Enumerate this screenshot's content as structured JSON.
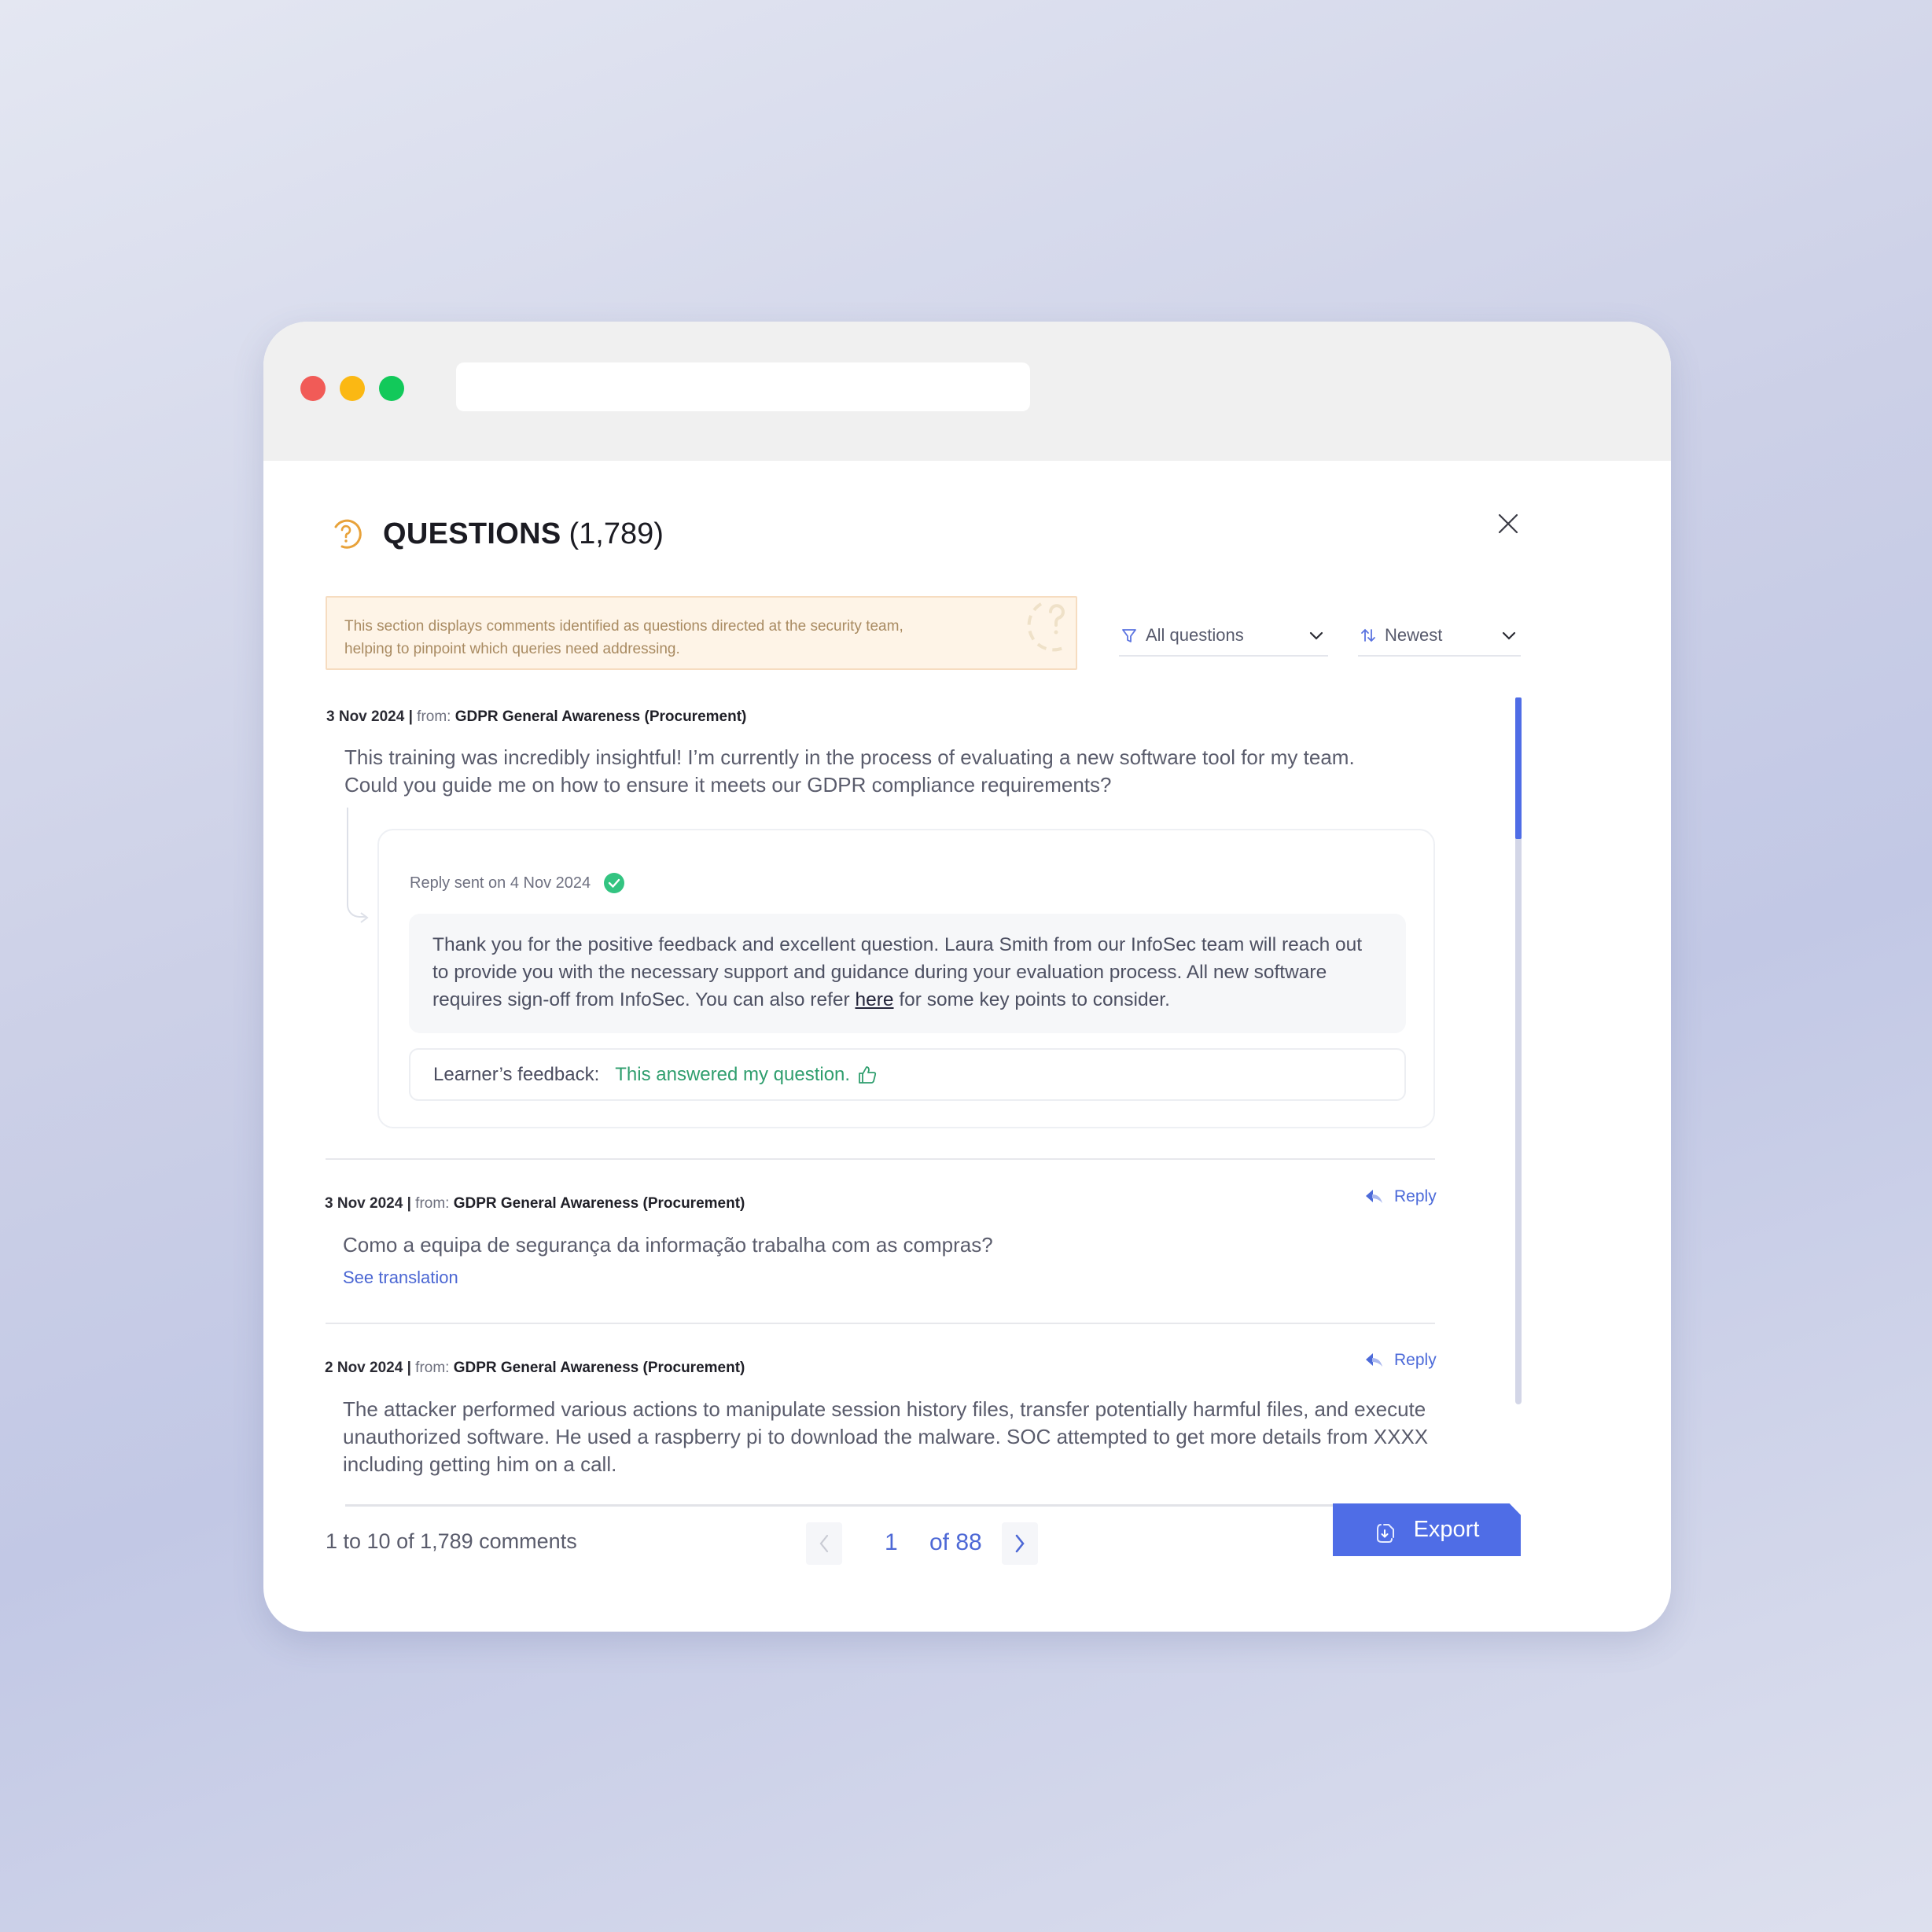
{
  "window": {
    "traffic_lights": [
      "close",
      "minimize",
      "maximize"
    ],
    "address_bar_value": ""
  },
  "header": {
    "icon": "question-circle-icon",
    "title": "QUESTIONS",
    "count": "(1,789)",
    "close_icon": "close-icon"
  },
  "info_banner": {
    "text": "This section displays comments identified as questions directed at the security team, helping to pinpoint which queries need addressing."
  },
  "filters": {
    "filter": {
      "icon": "filter-icon",
      "label": "All questions"
    },
    "sort": {
      "icon": "sort-icon",
      "label": "Newest"
    }
  },
  "scrollbar": {
    "position_fraction": 0.0,
    "visible_fraction": 0.2
  },
  "comments": [
    {
      "date": "3 Nov 2024",
      "separator": " | ",
      "from_label": "from: ",
      "source": "GDPR General Awareness (Procurement)",
      "text": "This training was incredibly insightful! I’m currently in the process of evaluating a new software tool for my team. Could you guide me on how to ensure it meets our GDPR compliance requirements?",
      "reply": {
        "sent_label": "Reply sent on 4 Nov 2024",
        "status": "sent",
        "body_before_link": "Thank you for the positive feedback and excellent question. Laura Smith from our InfoSec team will reach out to provide you with the necessary support and guidance during your evaluation process. All new software requires sign-off from InfoSec. You can also refer ",
        "link_text": "here",
        "body_after_link": " for some key points to consider.",
        "feedback_label": "Learner’s feedback:",
        "feedback_value": "This answered my question."
      }
    },
    {
      "date": "3 Nov 2024",
      "separator": " | ",
      "from_label": "from: ",
      "source": "GDPR General Awareness (Procurement)",
      "text": "Como a equipa de segurança da informação trabalha com as compras?",
      "reply_label": "Reply",
      "translation_label": "See translation"
    },
    {
      "date": "2 Nov 2024",
      "separator": " | ",
      "from_label": "from:  ",
      "source": "GDPR General Awareness (Procurement)",
      "text": "The attacker performed various actions to manipulate session history files, transfer potentially harmful files, and execute unauthorized software.  He used a raspberry pi to download the malware. SOC attempted to get more details from XXXX including getting him on a call.",
      "reply_label": "Reply"
    }
  ],
  "footer": {
    "summary": "1 to 10 of 1,789 comments",
    "current_page": "1",
    "total_pages_label": "of 88",
    "export_label": "Export"
  },
  "colors": {
    "accent": "#4f6de6",
    "success": "#2f9e6e",
    "warning_bg": "#fef4e7",
    "icon_orange": "#e8a23a"
  }
}
